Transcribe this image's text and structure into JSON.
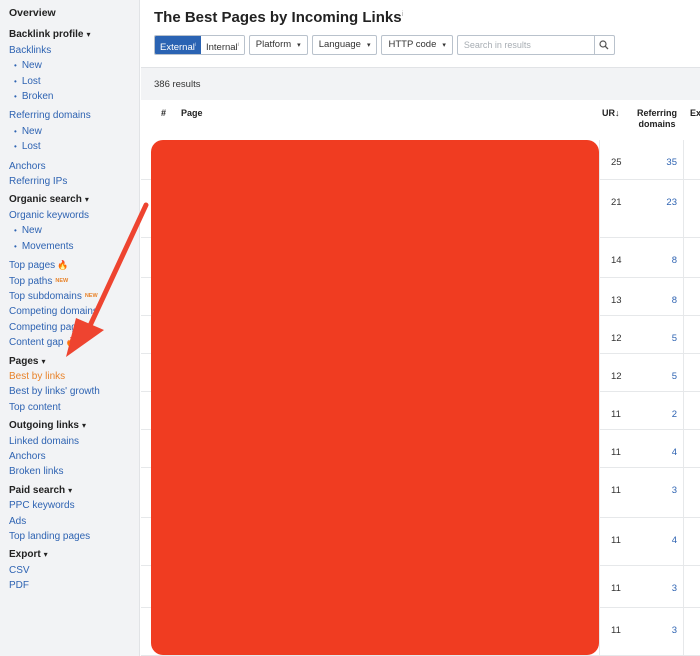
{
  "sidebar": {
    "overview": "Overview",
    "backlink_profile": {
      "label": "Backlink profile",
      "caret": "▾"
    },
    "backlinks": "Backlinks",
    "backlinks_sub": [
      "New",
      "Lost",
      "Broken"
    ],
    "referring_domains": "Referring domains",
    "referring_domains_sub": [
      "New",
      "Lost"
    ],
    "anchors": "Anchors",
    "referring_ips": "Referring IPs",
    "organic_search": {
      "label": "Organic search",
      "caret": "▾"
    },
    "organic_keywords": "Organic keywords",
    "organic_keywords_sub": [
      "New",
      "Movements"
    ],
    "top_pages": "Top pages",
    "top_paths": "Top paths",
    "top_paths_badge": "NEW",
    "top_subdomains": "Top subdomains",
    "top_subdomains_badge": "NEW",
    "competing_domains": "Competing domains",
    "competing_pages": "Competing pages",
    "content_gap": "Content gap",
    "pages": {
      "label": "Pages",
      "caret": "▾"
    },
    "best_by_links": "Best by links",
    "best_by_links_growth": "Best by links' growth",
    "top_content": "Top content",
    "outgoing_links": {
      "label": "Outgoing links",
      "caret": "▾"
    },
    "linked_domains": "Linked domains",
    "anchors_out": "Anchors",
    "broken_links": "Broken links",
    "paid_search": {
      "label": "Paid search",
      "caret": "▾"
    },
    "ppc_keywords": "PPC keywords",
    "ads": "Ads",
    "top_landing_pages": "Top landing pages",
    "export": {
      "label": "Export",
      "caret": "▾"
    },
    "csv": "CSV",
    "pdf": "PDF"
  },
  "main": {
    "title": "The Best Pages by Incoming Links",
    "title_info": "i",
    "toolbar": {
      "external": "External",
      "internal": "Internal",
      "info_mark": "i",
      "platform": "Platform",
      "language": "Language",
      "http_code": "HTTP code",
      "caret": "▾",
      "search_placeholder": "Search in results"
    },
    "results_count": "386 results",
    "columns": {
      "hash": "#",
      "page": "Page",
      "ur": "UR",
      "ur_sort": "↓",
      "referring_domains": "Referring domains",
      "extra": "Ex"
    },
    "rows": [
      {
        "ur": "25",
        "rd": "35"
      },
      {
        "ur": "21",
        "rd": "23"
      },
      {
        "ur": "14",
        "rd": "8"
      },
      {
        "ur": "13",
        "rd": "8"
      },
      {
        "ur": "12",
        "rd": "5"
      },
      {
        "ur": "12",
        "rd": "5"
      },
      {
        "ur": "11",
        "rd": "2"
      },
      {
        "ur": "11",
        "rd": "4"
      },
      {
        "ur": "11",
        "rd": "3"
      },
      {
        "ur": "11",
        "rd": "4"
      },
      {
        "ur": "11",
        "rd": "3"
      },
      {
        "ur": "11",
        "rd": "3"
      }
    ]
  },
  "colors": {
    "accent_blue": "#2a63b3",
    "link_blue": "#2e63b2",
    "active_orange": "#e8832a",
    "redaction_red": "#f03c21",
    "arrow_red": "#ee4430"
  }
}
